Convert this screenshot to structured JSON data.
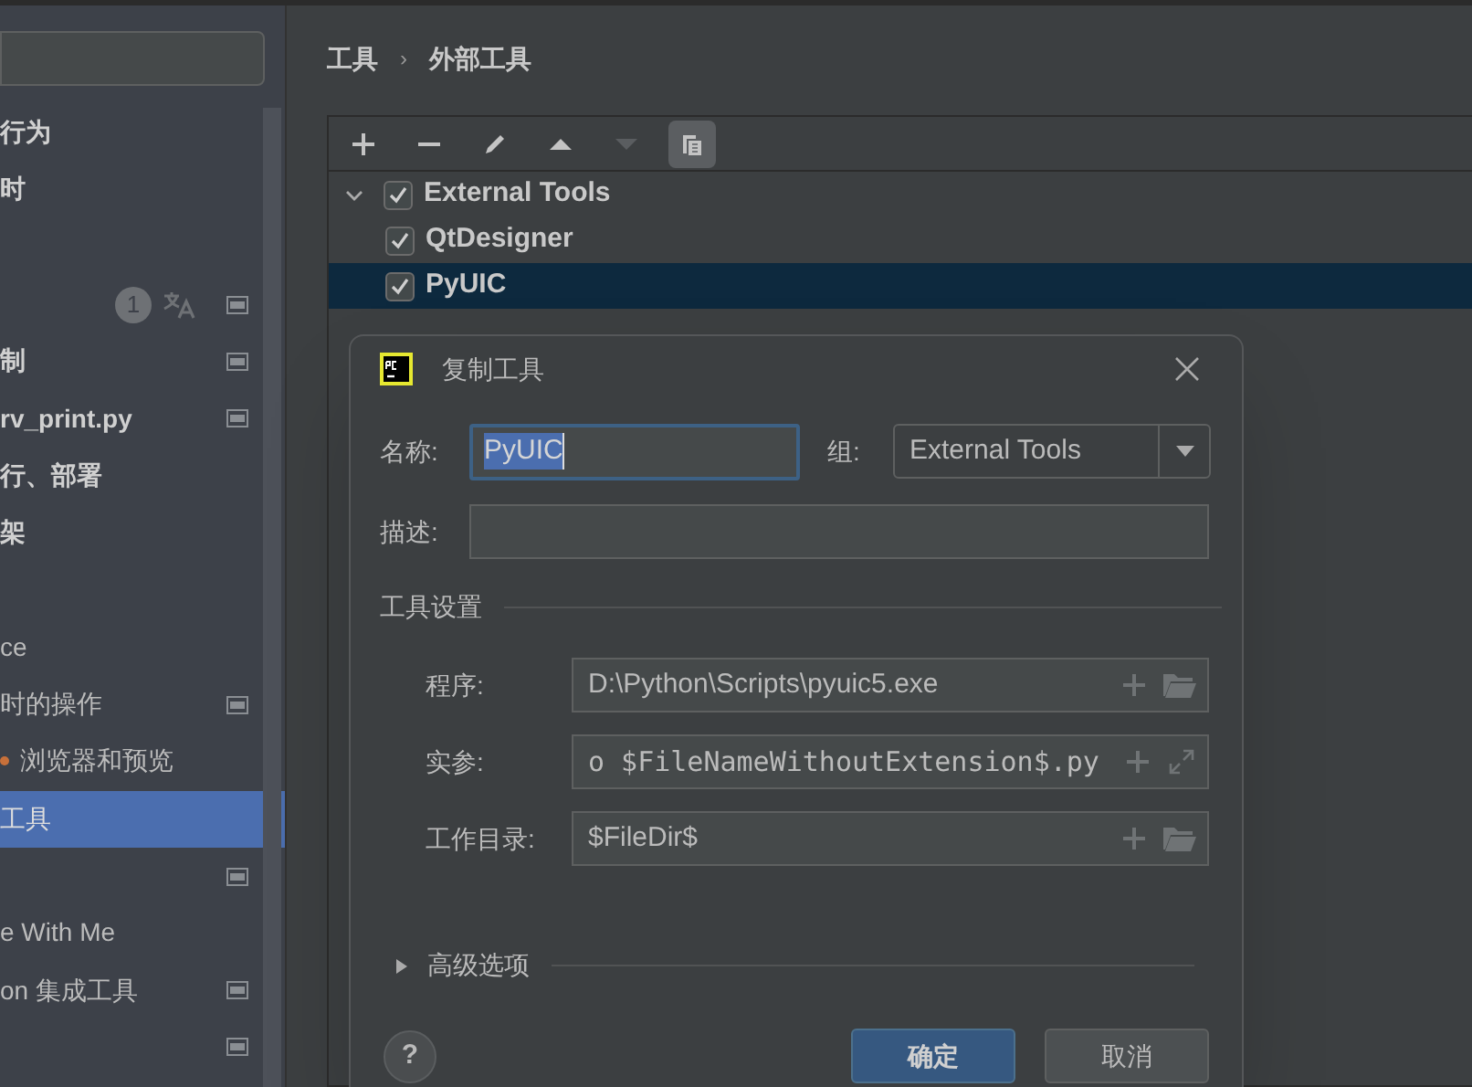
{
  "sidebar": {
    "items": [
      {
        "label": "行为",
        "bold": true,
        "selected": false
      },
      {
        "label": "时",
        "bold": true,
        "selected": false
      },
      {
        "selected": false
      },
      {
        "selected": false,
        "badge": "1",
        "translate": true,
        "project_level": true
      },
      {
        "label": "制",
        "bold": true,
        "selected": false,
        "project_level": true
      },
      {
        "label": "rv_print.py",
        "bold": true,
        "selected": false,
        "project_level": true
      },
      {
        "label": "行、部署",
        "bold": true,
        "selected": false
      },
      {
        "label": "架",
        "bold": true,
        "selected": false
      },
      {
        "selected": false
      },
      {
        "label": "ce",
        "bold": false,
        "selected": false
      },
      {
        "label": "时的操作",
        "bold": false,
        "selected": false,
        "project_level": true
      },
      {
        "label": "浏览器和预览",
        "bold": false,
        "selected": false,
        "dot": true
      },
      {
        "label": "工具",
        "bold": false,
        "selected": true
      },
      {
        "selected": false,
        "project_level": true
      },
      {
        "label": "e With Me",
        "bold": false,
        "selected": false
      },
      {
        "label": "on 集成工具",
        "bold": false,
        "selected": false,
        "project_level": true
      },
      {
        "selected": false,
        "project_level": true
      }
    ]
  },
  "breadcrumb": [
    "工具",
    "›",
    "外部工具"
  ],
  "toolbar": [
    {
      "kind": "add",
      "disabled": false,
      "pressed": false
    },
    {
      "kind": "remove",
      "disabled": false,
      "pressed": false
    },
    {
      "kind": "edit",
      "disabled": false,
      "pressed": false
    },
    {
      "kind": "up",
      "disabled": false,
      "pressed": false
    },
    {
      "kind": "down",
      "disabled": true,
      "pressed": false
    },
    {
      "kind": "copy",
      "disabled": false,
      "pressed": true
    }
  ],
  "tree": [
    {
      "label": "External Tools",
      "checked": true,
      "expanded": true,
      "selected": false,
      "children": [
        {
          "label": "QtDesigner",
          "checked": true,
          "selected": false
        },
        {
          "label": "PyUIC",
          "checked": true,
          "selected": true
        }
      ]
    }
  ],
  "dialog": {
    "title": "复制工具",
    "name": {
      "label": "名称:",
      "value": "PyUIC"
    },
    "group": {
      "label": "组:",
      "value": "External Tools"
    },
    "description": {
      "label": "描述:"
    },
    "section": "工具设置",
    "settings": [
      {
        "label": "程序:",
        "value": "D:\\Python\\Scripts\\pyuic5.exe",
        "kind": "browse",
        "mono": false
      },
      {
        "label": "实参:",
        "value": "o $FileNameWithoutExtension$.py",
        "kind": "expand",
        "mono": true
      },
      {
        "label": "工作目录:",
        "value": "$FileDir$",
        "kind": "browse",
        "mono": false
      }
    ],
    "advanced": {
      "label": "高级选项",
      "expanded": false
    },
    "help": "?",
    "ok": "确定",
    "cancel": "取消"
  }
}
